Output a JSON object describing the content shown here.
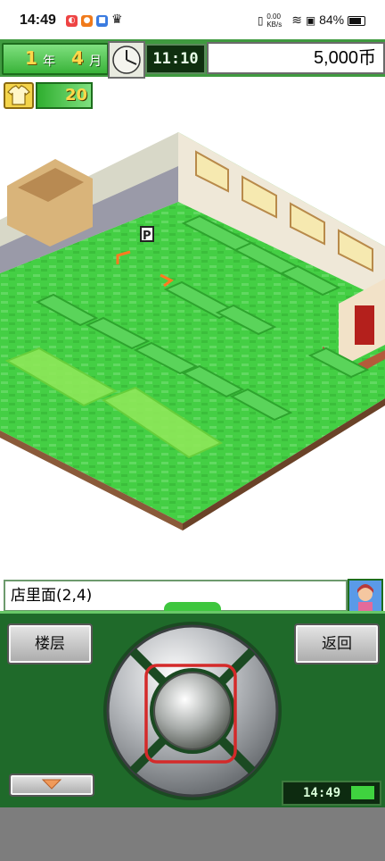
{
  "status_bar": {
    "time": "14:49",
    "network_speed": "0.00\nKB/s",
    "battery_percent": "84%"
  },
  "hud": {
    "year_value": "1",
    "year_unit": "年",
    "month_value": "4",
    "month_unit": "月",
    "game_time": "11:10",
    "money": "5,000币",
    "points": "20"
  },
  "location": {
    "text": "店里面(2,4)"
  },
  "controls": {
    "floor_label": "楼层",
    "back_label": "返回",
    "clock_readout": "14:49"
  },
  "colors": {
    "floor_green": "#3ed43e",
    "panel_green": "#1f6a2a",
    "highlight_red": "#d42a2a"
  }
}
